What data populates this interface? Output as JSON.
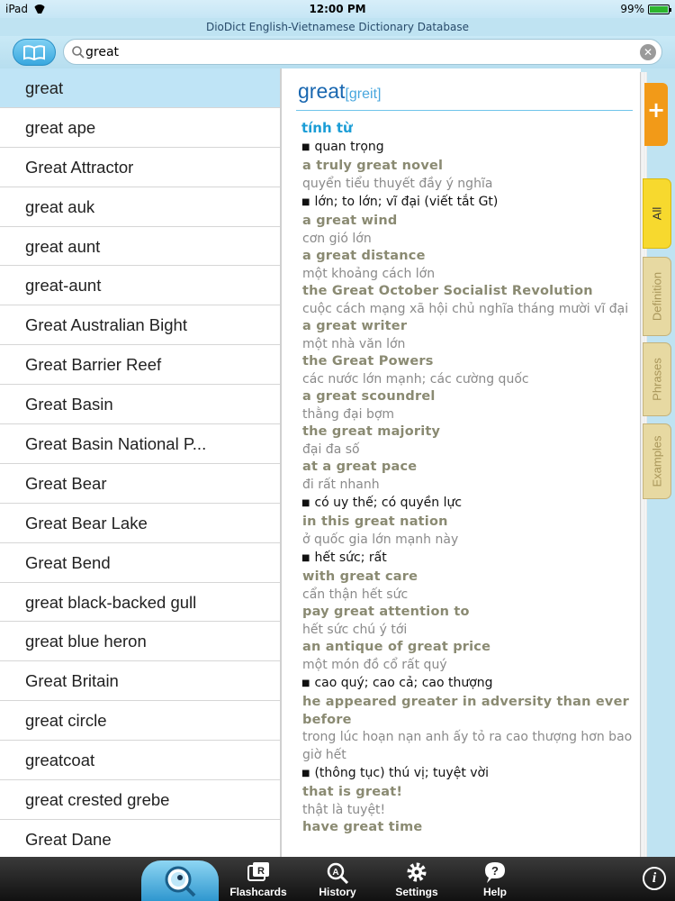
{
  "status": {
    "device": "iPad",
    "time": "12:00 PM",
    "battery": "99%"
  },
  "app_title": "DioDict English-Vietnamese Dictionary Database",
  "search": {
    "value": "great"
  },
  "word_list": [
    "great",
    "great ape",
    "Great Attractor",
    "great auk",
    "great aunt",
    "great-aunt",
    "Great Australian Bight",
    "Great Barrier Reef",
    "Great Basin",
    "Great Basin National P...",
    "Great Bear",
    "Great Bear Lake",
    "Great Bend",
    "great black-backed gull",
    "great blue heron",
    "Great Britain",
    "great circle",
    "greatcoat",
    "great crested grebe",
    "Great Dane"
  ],
  "entry": {
    "headword": "great",
    "phonetic": "[greit]",
    "lines": [
      {
        "t": "pos",
        "text": "tính từ"
      },
      {
        "t": "sense",
        "text": "quan trọng"
      },
      {
        "t": "ex",
        "text": "a truly great novel"
      },
      {
        "t": "tr",
        "text": "quyển tiểu thuyết đầy ý nghĩa"
      },
      {
        "t": "sense",
        "text": "lớn; to lớn; vĩ đại (viết tắt Gt)"
      },
      {
        "t": "ex",
        "text": "a great wind"
      },
      {
        "t": "tr",
        "text": "cơn gió lớn"
      },
      {
        "t": "ex",
        "text": "a great distance"
      },
      {
        "t": "tr",
        "text": "một khoảng cách lớn"
      },
      {
        "t": "ex",
        "text": "the Great October Socialist Revolution"
      },
      {
        "t": "tr",
        "text": "cuộc cách mạng xã hội chủ nghĩa tháng mười vĩ đại"
      },
      {
        "t": "ex",
        "text": "a great writer"
      },
      {
        "t": "tr",
        "text": "một nhà văn lớn"
      },
      {
        "t": "ex",
        "text": "the Great Powers"
      },
      {
        "t": "tr",
        "text": "các nước lớn mạnh; các cường quốc"
      },
      {
        "t": "ex",
        "text": "a great scoundrel"
      },
      {
        "t": "tr",
        "text": "thằng đại bợm"
      },
      {
        "t": "ex",
        "text": "the great majority"
      },
      {
        "t": "tr",
        "text": "đại đa số"
      },
      {
        "t": "ex",
        "text": "at a great pace"
      },
      {
        "t": "tr",
        "text": "đi rất nhanh"
      },
      {
        "t": "sense",
        "text": "có uy thế; có quyền lực"
      },
      {
        "t": "ex",
        "text": "in this great nation"
      },
      {
        "t": "tr",
        "text": "ở quốc gia lớn mạnh này"
      },
      {
        "t": "sense",
        "text": "hết sức; rất"
      },
      {
        "t": "ex",
        "text": "with great care"
      },
      {
        "t": "tr",
        "text": "cẩn thận hết sức"
      },
      {
        "t": "ex",
        "text": "pay great attention to"
      },
      {
        "t": "tr",
        "text": "hết sức chú ý tới"
      },
      {
        "t": "ex",
        "text": "an antique of great price"
      },
      {
        "t": "tr",
        "text": "một món đồ cổ rất quý"
      },
      {
        "t": "sense",
        "text": "cao quý; cao cả; cao thượng"
      },
      {
        "t": "ex",
        "text": "he appeared greater in adversity than ever before"
      },
      {
        "t": "tr",
        "text": "trong lúc hoạn nạn anh ấy tỏ ra cao thượng hơn bao giờ hết"
      },
      {
        "t": "sense",
        "text": "(thông tục) thú vị; tuyệt vời"
      },
      {
        "t": "ex",
        "text": "that is great!"
      },
      {
        "t": "tr",
        "text": "thật là tuyệt!"
      },
      {
        "t": "ex",
        "text": "have great time"
      }
    ]
  },
  "tabs": {
    "all": "All",
    "definition": "Definition",
    "phrases": "Phrases",
    "examples": "Examples",
    "add": "+"
  },
  "toolbar": {
    "flashcards": "Flashcards",
    "history": "History",
    "settings": "Settings",
    "help": "Help",
    "info": "i"
  }
}
